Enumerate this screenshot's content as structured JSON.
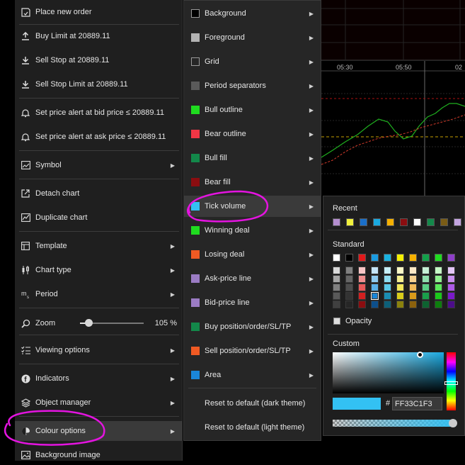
{
  "chart": {
    "time_labels": [
      "05:30",
      "05:50",
      "02"
    ]
  },
  "main_menu": {
    "items": [
      {
        "id": "place-new-order",
        "label": "Place new order",
        "icon": "order-icon"
      },
      {
        "id": "buy-limit",
        "label": "Buy Limit at 20889.11",
        "icon": "upload-arrow-icon"
      },
      {
        "id": "sell-stop",
        "label": "Sell Stop at 20889.11",
        "icon": "download-arrow-icon"
      },
      {
        "id": "sell-stop-limit",
        "label": "Sell Stop Limit at 20889.11",
        "icon": "download-arrow-icon"
      },
      {
        "id": "alert-bid",
        "label": "Set price alert at bid price ≤ 20889.11",
        "icon": "bell-icon"
      },
      {
        "id": "alert-ask",
        "label": "Set price alert at ask price ≤ 20889.11",
        "icon": "bell-icon"
      },
      {
        "id": "symbol",
        "label": "Symbol",
        "icon": "chart-window-icon"
      },
      {
        "id": "detach-chart",
        "label": "Detach chart",
        "icon": "external-link-icon"
      },
      {
        "id": "duplicate-chart",
        "label": "Duplicate chart",
        "icon": "duplicate-icon"
      },
      {
        "id": "template",
        "label": "Template",
        "icon": "template-icon"
      },
      {
        "id": "chart-type",
        "label": "Chart type",
        "icon": "candlestick-icon"
      },
      {
        "id": "period",
        "label": "Period",
        "icon": "period-icon"
      },
      {
        "id": "zoom",
        "label": "Zoom",
        "icon": "zoom-icon"
      },
      {
        "id": "viewing-options",
        "label": "Viewing options",
        "icon": "checklist-icon"
      },
      {
        "id": "indicators",
        "label": "Indicators",
        "icon": "indicator-f-icon"
      },
      {
        "id": "object-manager",
        "label": "Object manager",
        "icon": "layers-icon"
      },
      {
        "id": "colour-options",
        "label": "Colour options",
        "icon": "palette-icon"
      },
      {
        "id": "background-image",
        "label": "Background image",
        "icon": "image-icon"
      }
    ],
    "zoom_value": "105 %",
    "zoom_level_fraction": 0.13
  },
  "colour_menu": {
    "items": [
      {
        "label": "Background",
        "color": "#000000"
      },
      {
        "label": "Foreground",
        "color": "#b3b3b3"
      },
      {
        "label": "Grid",
        "color": "#262626"
      },
      {
        "label": "Period separators",
        "color": "#5a5a5a"
      },
      {
        "label": "Bull outline",
        "color": "#1fdc1f"
      },
      {
        "label": "Bear outline",
        "color": "#f23645"
      },
      {
        "label": "Bull fill",
        "color": "#13884a"
      },
      {
        "label": "Bear fill",
        "color": "#8b0d10"
      },
      {
        "label": "Tick volume",
        "color": "#33c1f3"
      },
      {
        "label": "Winning deal",
        "color": "#1fdc1f"
      },
      {
        "label": "Losing deal",
        "color": "#f05a23"
      },
      {
        "label": "Ask-price line",
        "color": "#9b7cc4"
      },
      {
        "label": "Bid-price line",
        "color": "#9b7cc4"
      },
      {
        "label": "Buy position/order/SL/TP",
        "color": "#13884a"
      },
      {
        "label": "Sell position/order/SL/TP",
        "color": "#f05a23"
      },
      {
        "label": "Area",
        "color": "#1a86d9"
      }
    ],
    "reset_dark": "Reset to default (dark theme)",
    "reset_light": "Reset to default (light theme)"
  },
  "picker": {
    "recent_title": "Recent",
    "recent_colors": [
      "#b48ecf",
      "#f0f03c",
      "#1a6fc9",
      "#1aa9e0",
      "#f5b000",
      "#8b0d10",
      "#ffffff",
      "#13884a",
      "#7a5c16",
      "#c3a4e0"
    ],
    "standard_title": "Standard",
    "standard_top": [
      "#ffffff",
      "#000000",
      "#e0191a",
      "#1a9ae0",
      "#1ab2e0",
      "#f5f000",
      "#f5b000",
      "#13a04a",
      "#1fdc1f",
      "#8e3ec9"
    ],
    "standard_columns": [
      [
        "#d9d9d9",
        "#a6a6a6",
        "#808080",
        "#595959",
        "#404040"
      ],
      [
        "#808080",
        "#666666",
        "#4d4d4d",
        "#333333",
        "#262626"
      ],
      [
        "#f7c6c6",
        "#f08f8f",
        "#e85a5a",
        "#d12020",
        "#8b0d10"
      ],
      [
        "#c6e4f7",
        "#8fcaf0",
        "#5ab0e8",
        "#1a86d9",
        "#0d4f8b"
      ],
      [
        "#c6eef7",
        "#8fdcf0",
        "#5ac9e8",
        "#1a8db3",
        "#0d5f78"
      ],
      [
        "#fbf8c6",
        "#f7f08f",
        "#f2e85a",
        "#d9cc1a",
        "#8b820d"
      ],
      [
        "#fbe8c6",
        "#f7d18f",
        "#f2ba5a",
        "#d99a1a",
        "#8b610d"
      ],
      [
        "#c6efd6",
        "#8fdfae",
        "#5acf86",
        "#1a9e4a",
        "#0d6330"
      ],
      [
        "#c6f7c6",
        "#8ff08f",
        "#5ae85a",
        "#1ac91a",
        "#0d7f0d"
      ],
      [
        "#e4c6f7",
        "#c98ff0",
        "#ad5ae8",
        "#7a1ac9",
        "#4c0d8b"
      ]
    ],
    "selected_cell": [
      3,
      3
    ],
    "opacity_label": "Opacity",
    "custom_title": "Custom",
    "hash": "#",
    "hex_value": "FF33C1F3",
    "current_color": "#33C1F3",
    "alpha_fraction": 1.0
  },
  "annotation_color": "#e414e0"
}
